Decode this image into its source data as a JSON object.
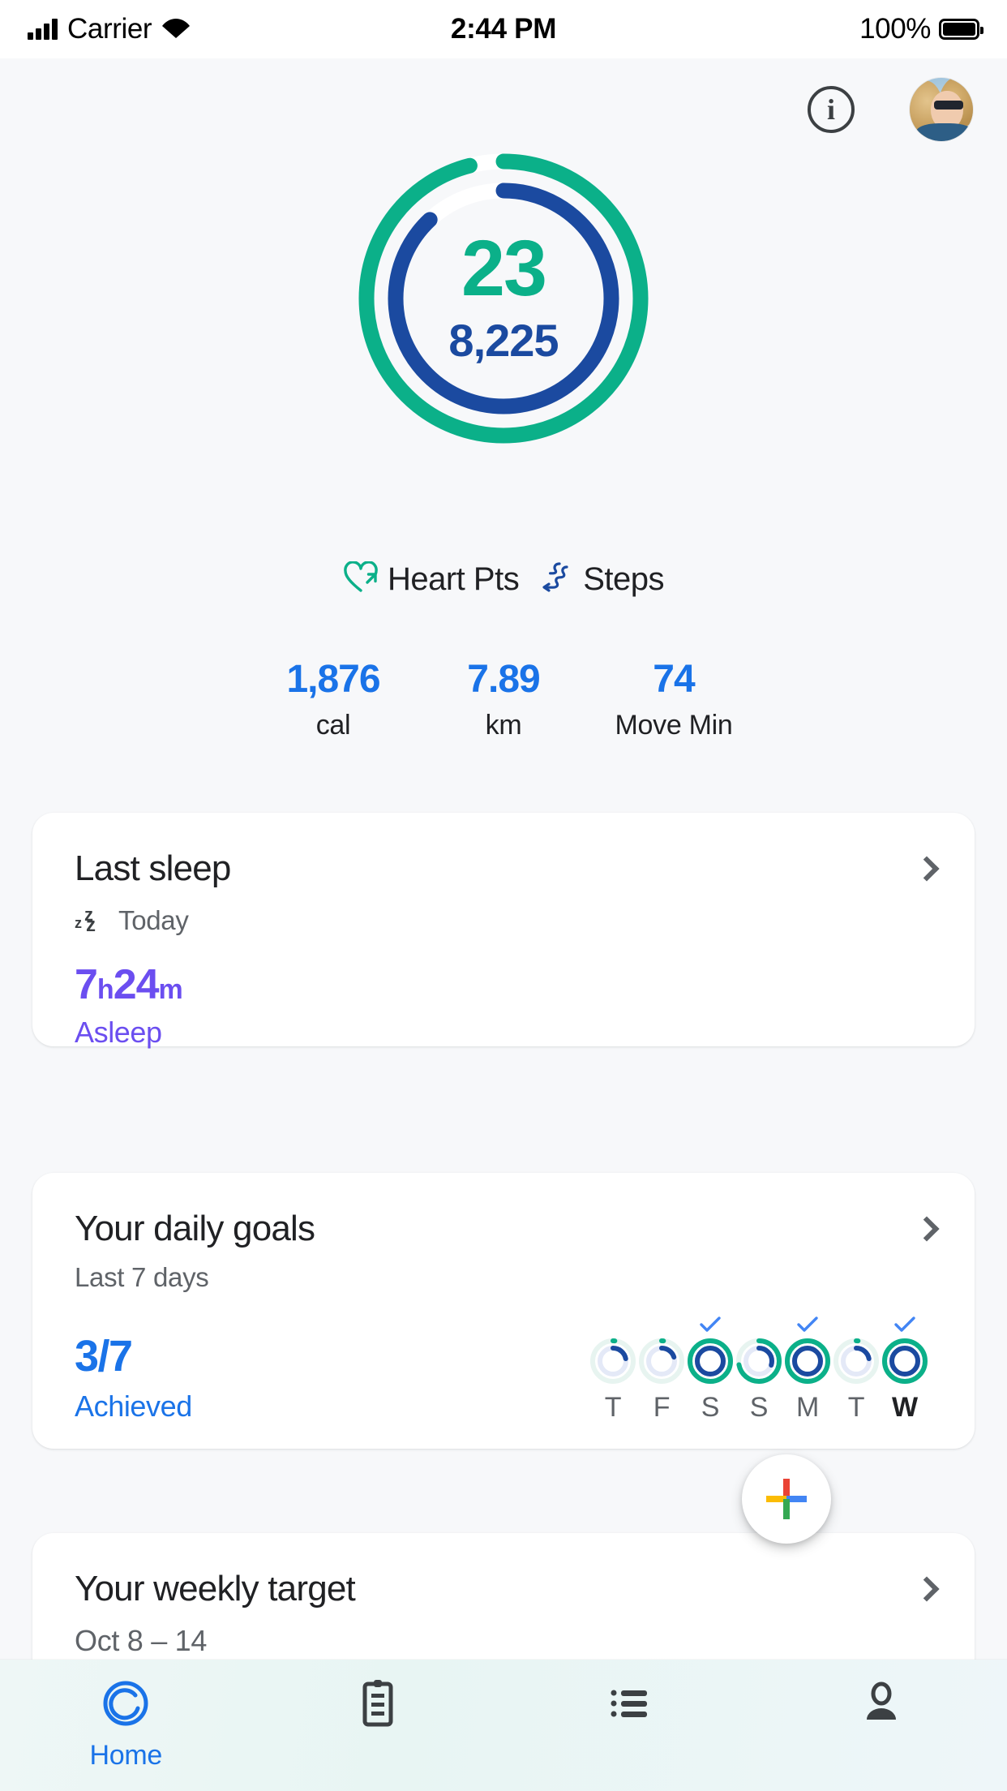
{
  "status_bar": {
    "carrier": "Carrier",
    "time": "2:44 PM",
    "battery_percent": "100%",
    "signal_icon": "signal-bars-icon",
    "wifi_icon": "wifi-icon",
    "battery_icon": "battery-icon"
  },
  "header": {
    "info_icon": "info-icon",
    "info_glyph": "i",
    "avatar_icon": "avatar-profile-photo"
  },
  "rings": {
    "heart_points": "23",
    "steps": "8,225",
    "heart_color": "#0bb089",
    "steps_color": "#1b4aa0",
    "heart_progress_pct": 96,
    "steps_progress_pct": 88,
    "track_color": "#ffffff"
  },
  "legend": [
    {
      "label": "Heart Pts",
      "icon": "heart-arrow-icon",
      "color": "#0bb089"
    },
    {
      "label": "Steps",
      "icon": "shoe-steps-icon",
      "color": "#1b4aa0"
    }
  ],
  "stats": [
    {
      "value": "1,876",
      "label": "cal"
    },
    {
      "value": "7.89",
      "label": "km"
    },
    {
      "value": "74",
      "label": "Move Min"
    }
  ],
  "cards": {
    "sleep": {
      "title": "Last sleep",
      "subtitle": "Today",
      "subtitle_icon": "zzz-sleep-icon",
      "hours": "7",
      "hours_unit": "h",
      "minutes": "24",
      "minutes_unit": "m",
      "state": "Asleep",
      "accent": "#6b4ef0",
      "chevron_icon": "chevron-right-icon"
    },
    "goals": {
      "title": "Your daily goals",
      "subtitle": "Last 7 days",
      "count": "3/7",
      "count_label": "Achieved",
      "chevron_icon": "chevron-right-icon",
      "days": [
        {
          "letter": "T",
          "achieved": false,
          "today": false,
          "heart_pct": 0,
          "steps_pct": 22,
          "check_icon": ""
        },
        {
          "letter": "F",
          "achieved": false,
          "today": false,
          "heart_pct": 0,
          "steps_pct": 20,
          "check_icon": ""
        },
        {
          "letter": "S",
          "achieved": true,
          "today": false,
          "heart_pct": 100,
          "steps_pct": 100,
          "check_icon": "check-icon"
        },
        {
          "letter": "S",
          "achieved": false,
          "today": false,
          "heart_pct": 72,
          "steps_pct": 30,
          "check_icon": ""
        },
        {
          "letter": "M",
          "achieved": true,
          "today": false,
          "heart_pct": 100,
          "steps_pct": 100,
          "check_icon": "check-icon"
        },
        {
          "letter": "T",
          "achieved": false,
          "today": false,
          "heart_pct": 0,
          "steps_pct": 22,
          "check_icon": ""
        },
        {
          "letter": "W",
          "achieved": true,
          "today": true,
          "heart_pct": 100,
          "steps_pct": 100,
          "check_icon": "check-icon"
        }
      ]
    },
    "weekly": {
      "title": "Your weekly target",
      "subtitle": "Oct 8 – 14",
      "chevron_icon": "chevron-right-icon"
    }
  },
  "fab": {
    "icon": "google-plus-add-icon",
    "colors": {
      "top": "#ea4335",
      "left": "#fbbc04",
      "right": "#4285f4",
      "bottom": "#34a853"
    }
  },
  "bottom_nav": [
    {
      "label": "Home",
      "icon": "home-target-icon",
      "active": true
    },
    {
      "label": "",
      "icon": "journal-clipboard-icon",
      "active": false
    },
    {
      "label": "",
      "icon": "browse-list-icon",
      "active": false
    },
    {
      "label": "",
      "icon": "profile-person-icon",
      "active": false
    }
  ]
}
